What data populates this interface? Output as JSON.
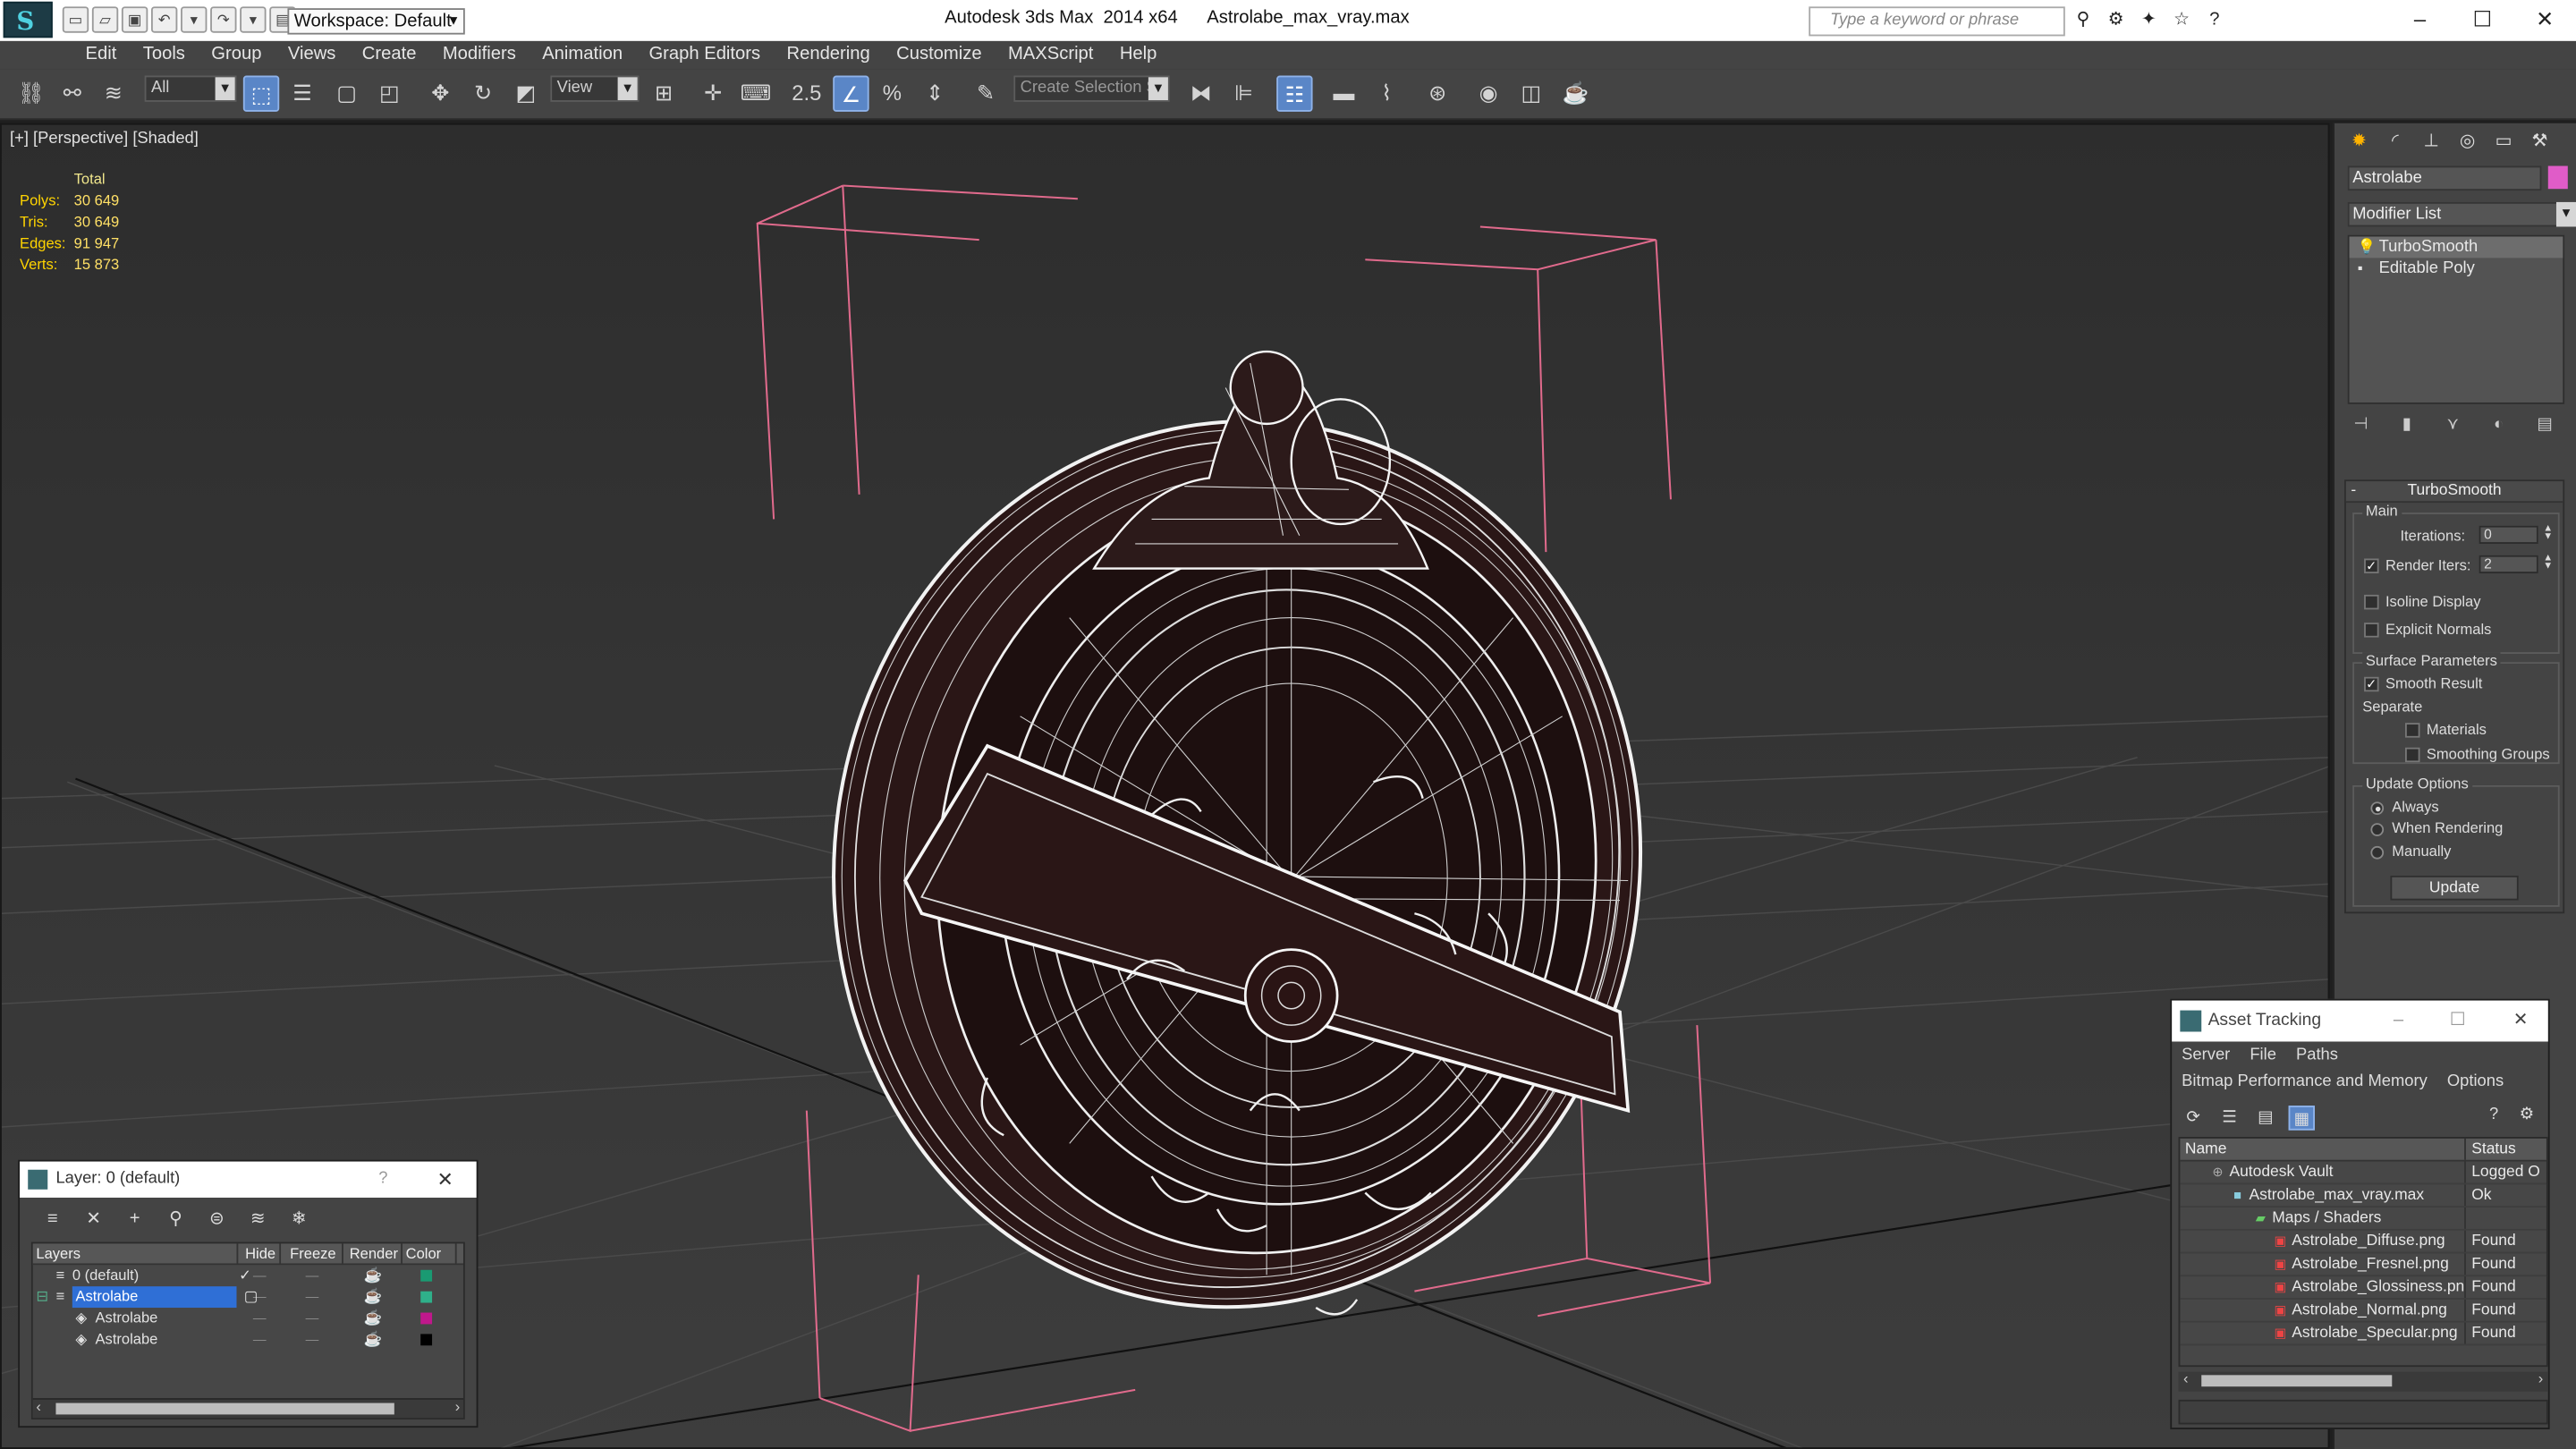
{
  "window": {
    "app_title": "Autodesk 3ds Max  2014 x64",
    "file_title": "Astrolabe_max_vray.max",
    "workspace": "Workspace: Default",
    "search_placeholder": "Type a keyword or phrase"
  },
  "menu": [
    "Edit",
    "Tools",
    "Group",
    "Views",
    "Create",
    "Modifiers",
    "Animation",
    "Graph Editors",
    "Rendering",
    "Customize",
    "MAXScript",
    "Help"
  ],
  "toolbar": {
    "selection_filter": "All",
    "ref_coord": "View",
    "selection_set_placeholder": "Create Selection Se",
    "snap_label": "2.5"
  },
  "viewport": {
    "label": "[+] [Perspective] [Shaded]",
    "stats": {
      "header": "Total",
      "rows": [
        {
          "k": "Polys:",
          "v": "30 649"
        },
        {
          "k": "Tris:",
          "v": "30 649"
        },
        {
          "k": "Edges:",
          "v": "91 947"
        },
        {
          "k": "Verts:",
          "v": "15 873"
        }
      ]
    }
  },
  "command_panel": {
    "object_name": "Astrolabe",
    "object_color": "#e05cc8",
    "modifier_list": "Modifier List",
    "stack": [
      "TurboSmooth",
      "Editable Poly"
    ],
    "rollout_title": "TurboSmooth",
    "main_group": "Main",
    "iterations_label": "Iterations:",
    "iterations_value": "0",
    "render_iters_label": "Render Iters:",
    "render_iters_value": "2",
    "isoline_label": "Isoline Display",
    "explicit_label": "Explicit Normals",
    "surface_group": "Surface Parameters",
    "smooth_label": "Smooth Result",
    "separate_label": "Separate",
    "materials_label": "Materials",
    "smoothing_label": "Smoothing Groups",
    "update_group": "Update Options",
    "always_label": "Always",
    "when_rendering_label": "When Rendering",
    "manually_label": "Manually",
    "update_button": "Update"
  },
  "layer_window": {
    "title": "Layer: 0 (default)",
    "help": "?",
    "headers": [
      "Layers",
      "Hide",
      "Freeze",
      "Render",
      "Color"
    ],
    "rows": [
      {
        "name": "0 (default)",
        "color": "#1a9a72"
      },
      {
        "name": "Astrolabe",
        "color": "#2fb08a"
      },
      {
        "name": "Astrolabe",
        "color": "#c0188c"
      },
      {
        "name": "Astrolabe",
        "color": "#000000"
      }
    ]
  },
  "asset_window": {
    "title": "Asset Tracking",
    "menu1": [
      "Server",
      "File",
      "Paths"
    ],
    "menu2": [
      "Bitmap Performance and Memory",
      "Options"
    ],
    "headers": [
      "Name",
      "Status"
    ],
    "rows": [
      {
        "name": "Autodesk Vault",
        "status": "Logged O"
      },
      {
        "name": "Astrolabe_max_vray.max",
        "status": "Ok"
      },
      {
        "name": "Maps / Shaders",
        "status": ""
      },
      {
        "name": "Astrolabe_Diffuse.png",
        "status": "Found"
      },
      {
        "name": "Astrolabe_Fresnel.png",
        "status": "Found"
      },
      {
        "name": "Astrolabe_Glossiness.png",
        "status": "Found"
      },
      {
        "name": "Astrolabe_Normal.png",
        "status": "Found"
      },
      {
        "name": "Astrolabe_Specular.png",
        "status": "Found"
      }
    ]
  }
}
